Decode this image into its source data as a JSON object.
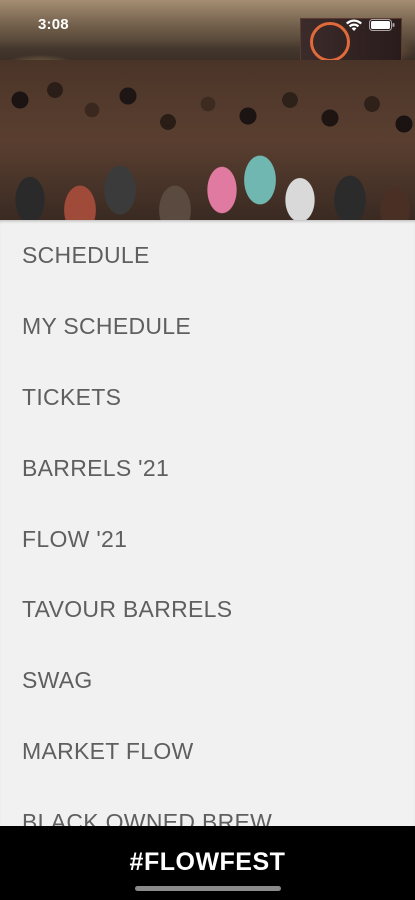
{
  "status_bar": {
    "time": "3:08",
    "wifi_icon": "wifi-icon",
    "battery_icon": "battery-icon"
  },
  "hero": {
    "image": "crowd-photo"
  },
  "menu": {
    "items": [
      {
        "label": "SCHEDULE"
      },
      {
        "label": "MY SCHEDULE"
      },
      {
        "label": "TICKETS"
      },
      {
        "label": "BARRELS '21"
      },
      {
        "label": "FLOW '21"
      },
      {
        "label": "TAVOUR BARRELS"
      },
      {
        "label": "SWAG"
      },
      {
        "label": "MARKET FLOW"
      },
      {
        "label": "BLACK OWNED BREW"
      }
    ]
  },
  "bottom_bar": {
    "label": "#FLOWFEST"
  },
  "colors": {
    "menu_background": "#f1f1f1",
    "menu_text": "#5f5f5f",
    "bottom_bar_background": "#000000",
    "bottom_bar_text": "#ffffff"
  }
}
